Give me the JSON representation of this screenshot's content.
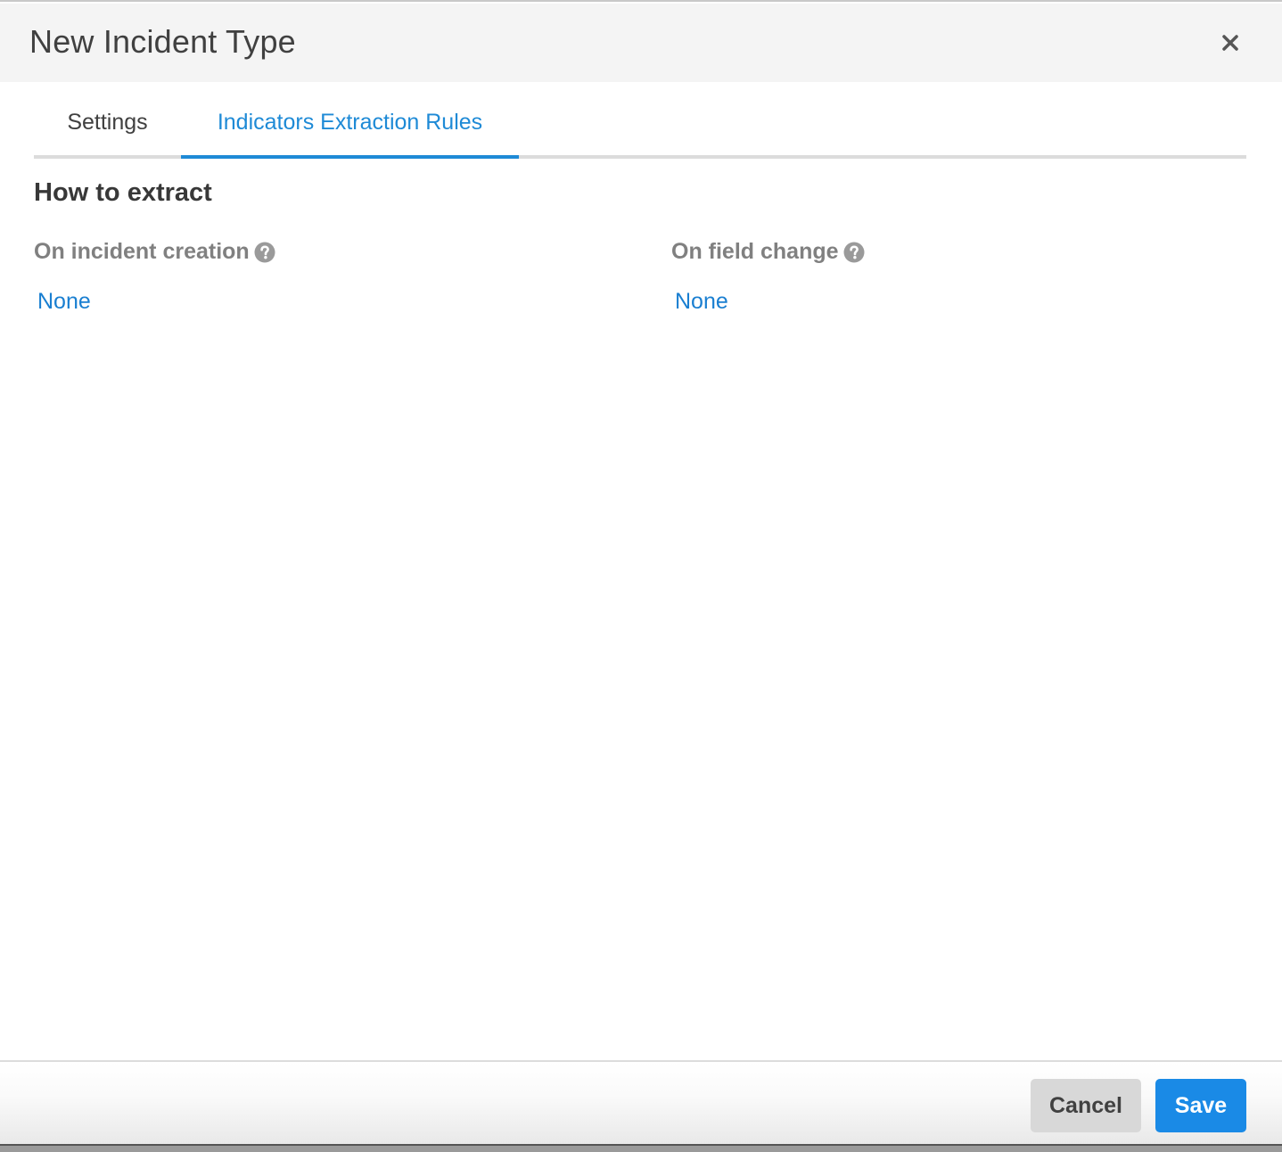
{
  "dialog": {
    "title": "New Incident Type",
    "close_icon": "close-icon"
  },
  "tabs": [
    {
      "label": "Settings",
      "active": false
    },
    {
      "label": "Indicators Extraction Rules",
      "active": true
    }
  ],
  "section": {
    "title": "How to extract",
    "columns": [
      {
        "label": "On incident creation",
        "help_icon": "question-circle-icon",
        "value": "None"
      },
      {
        "label": "On field change",
        "help_icon": "question-circle-icon",
        "value": "None"
      }
    ]
  },
  "footer": {
    "cancel_label": "Cancel",
    "save_label": "Save"
  },
  "colors": {
    "accent": "#1e8ad6",
    "save_button": "#1a8ae6",
    "link": "#1a7fd1",
    "label_gray": "#808080"
  }
}
